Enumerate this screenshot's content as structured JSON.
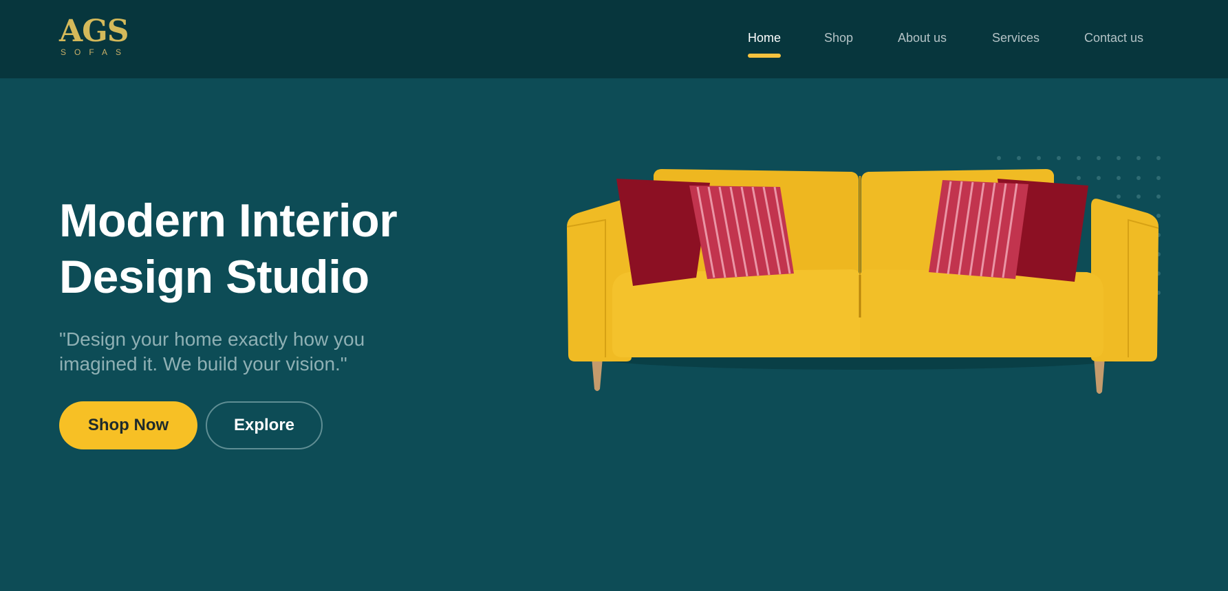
{
  "brand": {
    "logo_mark": "AGS",
    "logo_sub": "SOFAS",
    "accent_color": "#f7c025",
    "header_bg": "#07363d",
    "hero_bg": "#0d4c56"
  },
  "nav": {
    "items": [
      {
        "label": "Home",
        "active": true
      },
      {
        "label": "Shop",
        "active": false
      },
      {
        "label": "About us",
        "active": false
      },
      {
        "label": "Services",
        "active": false
      },
      {
        "label": "Contact us",
        "active": false
      }
    ]
  },
  "hero": {
    "title_line1": "Modern Interior",
    "title_line2": "Design Studio",
    "quote": "\"Design your home exactly how you imagined it. We build your vision.\"",
    "primary_button": "Shop Now",
    "secondary_button": "Explore"
  },
  "image": {
    "subject": "yellow-sofa-with-red-cushions"
  }
}
